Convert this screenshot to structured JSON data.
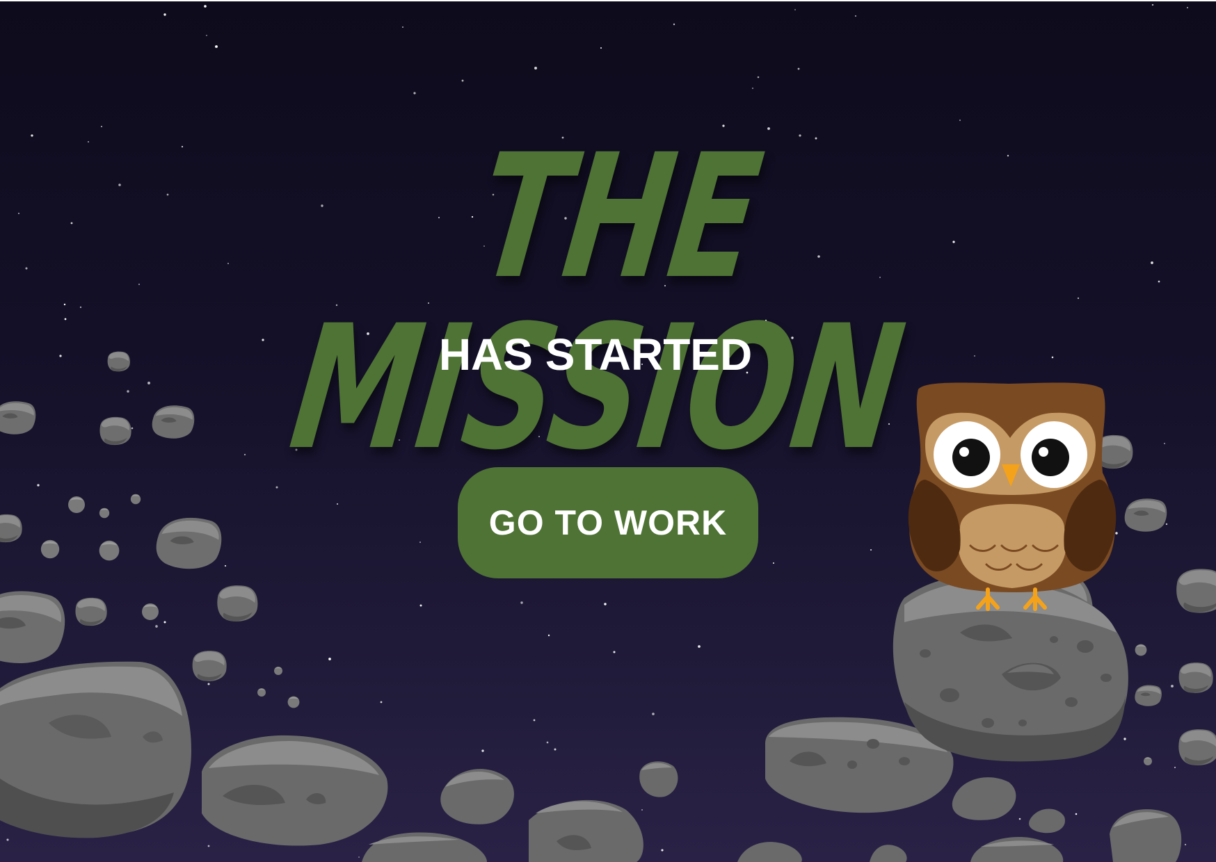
{
  "title": "THE MISSION",
  "subtitle": "HAS STARTED",
  "cta": {
    "label": "GO TO WORK"
  },
  "mascot": {
    "icon": "owl-icon"
  },
  "colors": {
    "title": "#4e7334",
    "button": "#4e7334",
    "sky_top": "#0e0b1c",
    "sky_bottom": "#2a2246",
    "asteroid_light": "#8a8a8a",
    "asteroid_mid": "#6e6e6e",
    "asteroid_dark": "#4d4d4d",
    "owl_body": "#7a4a22",
    "owl_belly": "#c69a64",
    "owl_feet": "#f5a21b"
  }
}
